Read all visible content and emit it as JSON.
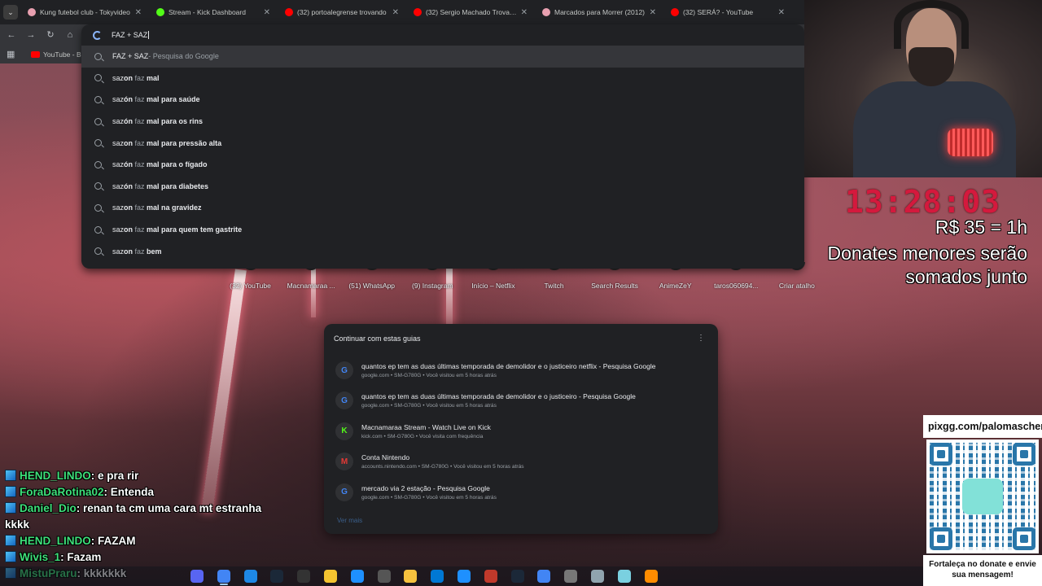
{
  "browser": {
    "tabs": [
      {
        "title": "Kung futebol club - Tokyvideo",
        "icon_color": "#e8a0b0"
      },
      {
        "title": "Stream - Kick Dashboard",
        "icon_color": "#53fc18"
      },
      {
        "title": "(32) portoalegrense trovando",
        "icon_color": "#ff0000"
      },
      {
        "title": "(32) Sergio Machado Trovando",
        "icon_color": "#ff0000"
      },
      {
        "title": "Marcados para Morrer (2012)",
        "icon_color": "#e8a0b0"
      },
      {
        "title": "(32) SERÁ? - YouTube",
        "icon_color": "#ff0000"
      }
    ],
    "bookmark": "YouTube - Br",
    "omnibox": {
      "query": "FAZ + SAZ",
      "first_suggestion": {
        "query": "FAZ + SAZ",
        "suffix": " - Pesquisa do Google"
      },
      "suggestions": [
        {
          "a": "saz",
          "b": "on",
          "c": " faz ",
          "d": "mal"
        },
        {
          "a": "saz",
          "b": "ón",
          "c": " faz ",
          "d": "mal para saúde"
        },
        {
          "a": "saz",
          "b": "ón",
          "c": " faz ",
          "d": "mal para os rins"
        },
        {
          "a": "saz",
          "b": "on",
          "c": " faz ",
          "d": "mal para pressão alta"
        },
        {
          "a": "saz",
          "b": "ón",
          "c": " faz ",
          "d": "mal para o fígado"
        },
        {
          "a": "saz",
          "b": "ón",
          "c": " faz ",
          "d": "mal para diabetes"
        },
        {
          "a": "saz",
          "b": "on",
          "c": " faz ",
          "d": "mal na gravidez"
        },
        {
          "a": "saz",
          "b": "on",
          "c": " faz ",
          "d": "mal para quem tem gastrite"
        },
        {
          "a": "saz",
          "b": "on",
          "c": " faz ",
          "d": "bem"
        }
      ]
    },
    "shortcuts": [
      "(32) YouTube",
      "Macnamaraa ...",
      "(51) WhatsApp",
      "(9) Instagram",
      "Início – Netflix",
      "Twitch",
      "Search Results",
      "AnimeZeY",
      "taros060694...",
      "Criar atalho"
    ],
    "continue_panel": {
      "title": "Continuar com estas guias",
      "items": [
        {
          "icon": "G",
          "icon_color": "#4285f4",
          "title": "quantos ep tem as duas últimas temporada de demolidor e o justiceiro netflix - Pesquisa Google",
          "meta": "google.com • SM-G780G • Você visitou em 5 horas atrás"
        },
        {
          "icon": "G",
          "icon_color": "#4285f4",
          "title": "quantos ep tem as duas últimas temporada de demolidor e o justiceiro - Pesquisa Google",
          "meta": "google.com • SM-G780G • Você visitou em 5 horas atrás"
        },
        {
          "icon": "K",
          "icon_color": "#53fc18",
          "title": "Macnamaraa Stream - Watch Live on Kick",
          "meta": "kick.com • SM-G780G • Você visita com frequência"
        },
        {
          "icon": "M",
          "icon_color": "#e53935",
          "title": "Conta Nintendo",
          "meta": "accounts.nintendo.com • SM-G780G • Você visitou em 5 horas atrás"
        },
        {
          "icon": "G",
          "icon_color": "#4285f4",
          "title": "mercado via 2 estação - Pesquisa Google",
          "meta": "google.com • SM-G780G • Você visitou em 5 horas atrás"
        }
      ],
      "faded": "Ver mais"
    }
  },
  "stream": {
    "timer": "13:28:03",
    "rate": "R$ 35 = 1h",
    "donate_note": "Donates menores serão somados junto",
    "pix_url": "pixgg.com/palomascher",
    "pix_footer": "Fortaleça no donate e envie sua mensagem!",
    "chat": [
      {
        "user": "HEND_LINDO",
        "text": ": e pra rir"
      },
      {
        "user": "ForaDaRotina02",
        "text": ": Entenda"
      },
      {
        "user": "Daniel_Dio",
        "text": ": renan ta cm uma cara mt estranha kkkk"
      },
      {
        "user": "HEND_LINDO",
        "text": ": FAZAM"
      },
      {
        "user": "Wivis_1",
        "text": ": Fazam"
      },
      {
        "user": "MistuPraru",
        "text": ": kkkkkkk"
      }
    ]
  },
  "taskbar": {
    "icons": [
      "discord-icon",
      "chrome-icon",
      "app-blue-icon",
      "steam-icon",
      "epic-icon",
      "folder-icon",
      "edge-icon",
      "xbox-icon",
      "notes-icon",
      "vscode-icon",
      "butterfly-icon",
      "obs-icon",
      "steam2-icon",
      "chrome2-icon",
      "settings-icon",
      "monitor-icon",
      "notepad-icon",
      "vlc-icon"
    ]
  },
  "colors": {
    "timer": "#d4193d",
    "chat_user": "#3ee07a",
    "kick": "#53fc18"
  }
}
